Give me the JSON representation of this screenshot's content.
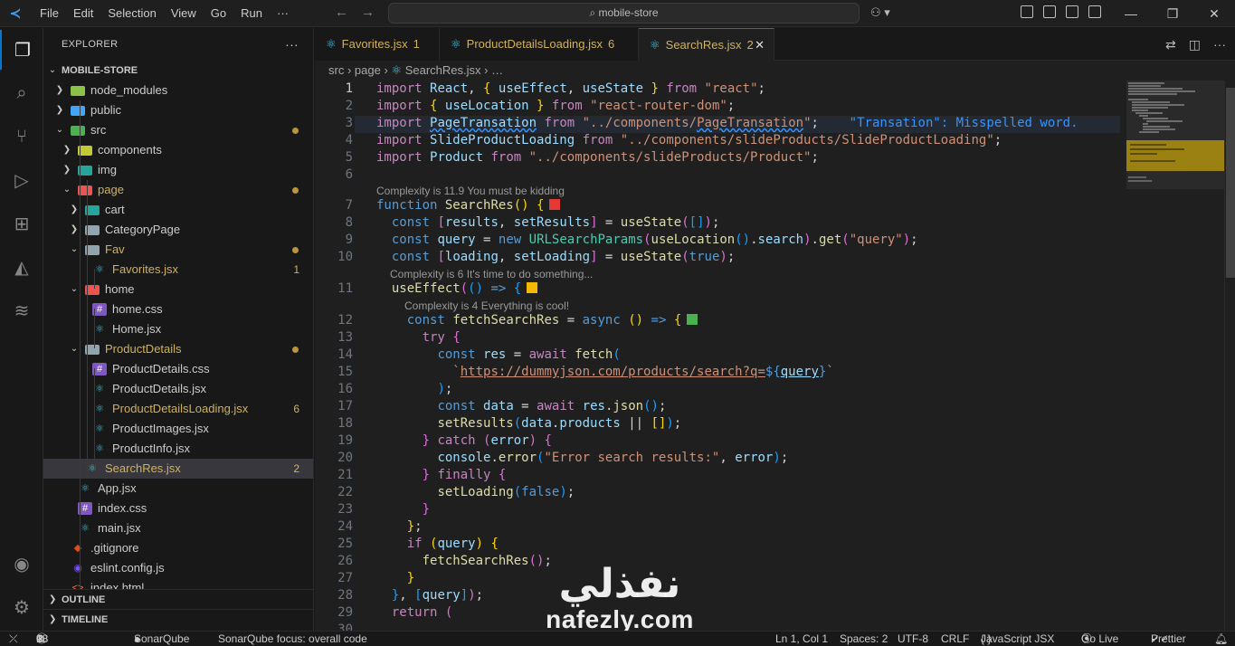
{
  "titlebar": {
    "menu": [
      "File",
      "Edit",
      "Selection",
      "View",
      "Go",
      "Run",
      "···"
    ],
    "search": "mobile-store"
  },
  "explorer": {
    "title": "EXPLORER",
    "root": "MOBILE-STORE",
    "items": [
      {
        "label": "node_modules",
        "depth": 1,
        "kind": "folder",
        "open": false,
        "color": "#8bc34a"
      },
      {
        "label": "public",
        "depth": 1,
        "kind": "folder",
        "open": false,
        "color": "#42a5f5"
      },
      {
        "label": "src",
        "depth": 1,
        "kind": "folder",
        "open": true,
        "color": "#4caf50",
        "dot": true
      },
      {
        "label": "components",
        "depth": 2,
        "kind": "folder",
        "open": false,
        "color": "#c0ca33"
      },
      {
        "label": "img",
        "depth": 2,
        "kind": "folder",
        "open": false,
        "color": "#26a69a"
      },
      {
        "label": "page",
        "depth": 2,
        "kind": "folder",
        "open": true,
        "color": "#ef5350",
        "dot": true,
        "text_color": "#d1b15a"
      },
      {
        "label": "cart",
        "depth": 3,
        "kind": "folder",
        "open": false,
        "color": "#26a69a"
      },
      {
        "label": "CategoryPage",
        "depth": 3,
        "kind": "folder",
        "open": false,
        "color": "#90a4ae"
      },
      {
        "label": "Fav",
        "depth": 3,
        "kind": "folder",
        "open": true,
        "color": "#90a4ae",
        "dot": true,
        "text_color": "#d1b15a"
      },
      {
        "label": "Favorites.jsx",
        "depth": 4,
        "kind": "react",
        "badge": "1",
        "text_color": "#d1b15a"
      },
      {
        "label": "home",
        "depth": 3,
        "kind": "folder",
        "open": true,
        "color": "#ef5350"
      },
      {
        "label": "home.css",
        "depth": 4,
        "kind": "css"
      },
      {
        "label": "Home.jsx",
        "depth": 4,
        "kind": "react"
      },
      {
        "label": "ProductDetails",
        "depth": 3,
        "kind": "folder",
        "open": true,
        "color": "#90a4ae",
        "dot": true,
        "text_color": "#d1b15a"
      },
      {
        "label": "ProductDetails.css",
        "depth": 4,
        "kind": "css"
      },
      {
        "label": "ProductDetails.jsx",
        "depth": 4,
        "kind": "react"
      },
      {
        "label": "ProductDetailsLoading.jsx",
        "depth": 4,
        "kind": "react",
        "badge": "6",
        "text_color": "#d1b15a"
      },
      {
        "label": "ProductImages.jsx",
        "depth": 4,
        "kind": "react"
      },
      {
        "label": "ProductInfo.jsx",
        "depth": 4,
        "kind": "react"
      },
      {
        "label": "SearchRes.jsx",
        "depth": 3,
        "kind": "react",
        "badge": "2",
        "text_color": "#d1b15a",
        "selected": true
      },
      {
        "label": "App.jsx",
        "depth": 2,
        "kind": "react"
      },
      {
        "label": "index.css",
        "depth": 2,
        "kind": "css"
      },
      {
        "label": "main.jsx",
        "depth": 2,
        "kind": "react"
      },
      {
        "label": ".gitignore",
        "depth": 1,
        "kind": "git"
      },
      {
        "label": "eslint.config.js",
        "depth": 1,
        "kind": "eslint"
      },
      {
        "label": "index.html",
        "depth": 1,
        "kind": "html"
      }
    ],
    "outline": "OUTLINE",
    "timeline": "TIMELINE"
  },
  "tabs": [
    {
      "label": "Favorites.jsx",
      "count": "1",
      "active": false
    },
    {
      "label": "ProductDetailsLoading.jsx",
      "count": "6",
      "active": false
    },
    {
      "label": "SearchRes.jsx",
      "count": "2",
      "active": true
    }
  ],
  "breadcrumb": {
    "a": "src",
    "b": "page",
    "c": "SearchRes.jsx",
    "d": "…"
  },
  "lens": {
    "fn": "Complexity is 11.9 You must be kidding",
    "effect": "Complexity is 6 It's time to do something...",
    "fetch": "Complexity is 4 Everything is cool!"
  },
  "code_lines": [
    "1",
    "2",
    "3",
    "4",
    "5",
    "6",
    "7",
    "8",
    "9",
    "10",
    "11",
    "12",
    "13",
    "14",
    "15",
    "16",
    "17",
    "18",
    "19",
    "20",
    "21",
    "22",
    "23",
    "24",
    "25",
    "26",
    "27",
    "28",
    "29",
    "30"
  ],
  "status": {
    "errors": "0",
    "warnings": "9",
    "infos": "18",
    "sonar": "SonarQube",
    "sonar_focus": "SonarQube focus: overall code",
    "position": "Ln 1, Col 1",
    "spaces": "Spaces: 2",
    "encoding": "UTF-8",
    "eol": "CRLF",
    "language": "JavaScript JSX",
    "golive": "Go Live",
    "prettier": "Prettier"
  },
  "watermark": {
    "arabic": "نفذلي",
    "latin": "nafezly.com"
  },
  "colors": {
    "accent": "#0078d4",
    "modified": "#d1b15a",
    "react": "#3ec5e6"
  }
}
